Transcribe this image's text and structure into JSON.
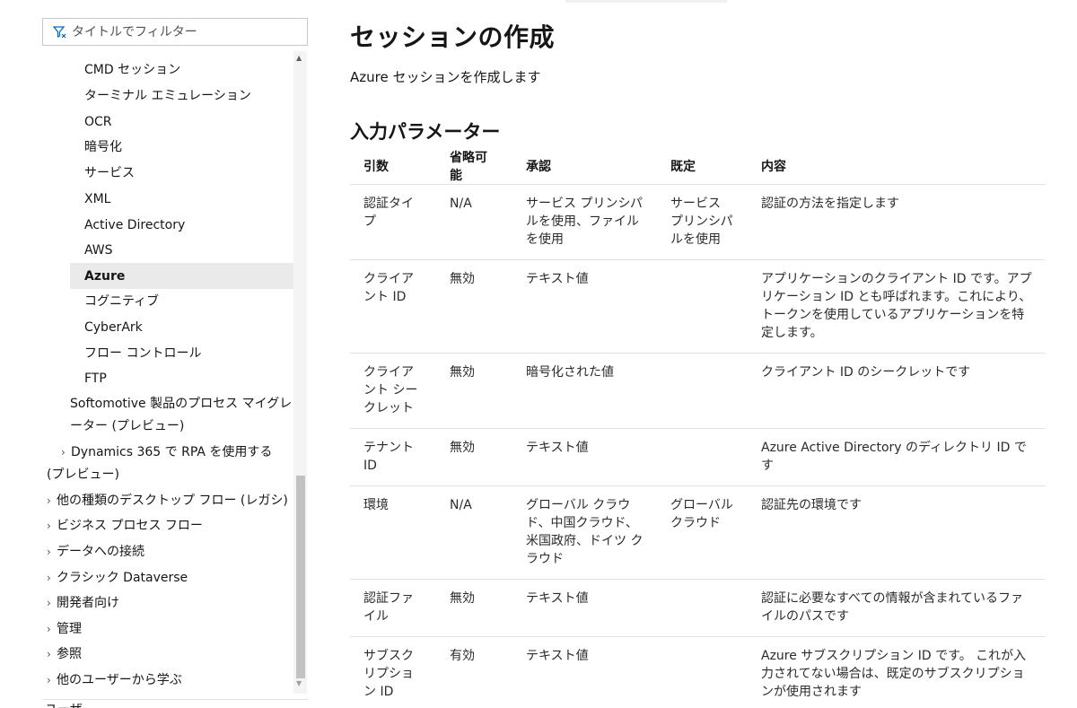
{
  "sidebar": {
    "filter_placeholder": "タイトルでフィルター",
    "items_l2": [
      "CMD セッション",
      "ターミナル エミュレーション",
      "OCR",
      "暗号化",
      "サービス",
      "XML",
      "Active Directory",
      "AWS",
      "Azure",
      "コグニティブ",
      "CyberArk",
      "フロー コントロール",
      "FTP"
    ],
    "item_l1_softomotive": "Softomotive 製品のプロセス マイグレーター (プレビュー)",
    "item_l1_dynamics": "Dynamics 365 で RPA を使用する (プレビュー)",
    "items_l0": [
      "他の種類のデスクトップ フロー (レガシ)",
      "ビジネス プロセス フロー",
      "データへの接続",
      "クラシック Dataverse",
      "開発者向け",
      "管理",
      "参照",
      "他のユーザーから学ぶ"
    ],
    "bottom_partial": "ユーザ"
  },
  "main": {
    "title": "セッションの作成",
    "description": "Azure セッションを作成します",
    "section_title": "入力パラメーター",
    "table": {
      "headers": [
        "引数",
        "省略可能",
        "承認",
        "既定",
        "内容"
      ],
      "rows": [
        [
          "認証タイプ",
          "N/A",
          "サービス プリンシパルを使用、ファイルを使用",
          "サービス プリンシパルを使用",
          "認証の方法を指定します"
        ],
        [
          "クライアント ID",
          "無効",
          "テキスト値",
          "",
          "アプリケーションのクライアント ID です。アプリケーション ID とも呼ばれます。これにより、トークンを使用しているアプリケーションを特定します。"
        ],
        [
          "クライアント シークレット",
          "無効",
          "暗号化された値",
          "",
          "クライアント ID のシークレットです"
        ],
        [
          "テナント ID",
          "無効",
          "テキスト値",
          "",
          "Azure Active Directory のディレクトリ ID です"
        ],
        [
          "環境",
          "N/A",
          "グローバル クラウド、中国クラウド、米国政府、ドイツ クラウド",
          "グローバル クラウド",
          "認証先の環境です"
        ],
        [
          "認証ファイル",
          "無効",
          "テキスト値",
          "",
          "認証に必要なすべての情報が含まれているファイルのパスです"
        ],
        [
          "サブスクリプション ID",
          "有効",
          "テキスト値",
          "",
          "Azure サブスクリプション ID です。 これが入力されてない場合は、既定のサブスクリプションが使用されます"
        ]
      ]
    }
  }
}
